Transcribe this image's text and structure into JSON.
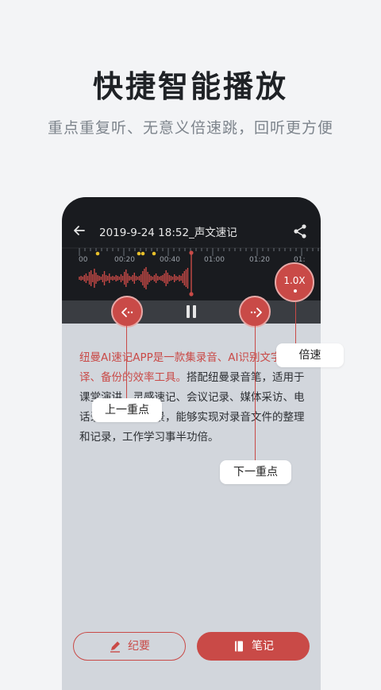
{
  "headline": "快捷智能播放",
  "subline": "重点重复听、无意义倍速跳，回听更方便",
  "player": {
    "title": "2019-9-24 18:52_声文速记",
    "timeline_labels": [
      "00",
      "00:20",
      "00:40",
      "01:00",
      "01:20",
      "01:"
    ],
    "speed": "1.0X"
  },
  "body_text": {
    "highlight": "纽曼AI速记APP是一款集录音、AI识别文字、翻译、备份的效率工具。",
    "normal": "搭配纽曼录音笔，适用于课堂演讲、灵感速记、会议记录、媒体采访、电话录音等多种场景，能够实现对录音文件的整理和记录，工作学习事半功倍。"
  },
  "tooltips": {
    "speed": "倍速",
    "prev": "上一重点",
    "next": "下一重点"
  },
  "buttons": {
    "summary": "纪要",
    "notes": "笔记"
  },
  "colors": {
    "accent": "#c94a47",
    "dark_bar": "#191b1f",
    "marker": "#e8c02a"
  }
}
